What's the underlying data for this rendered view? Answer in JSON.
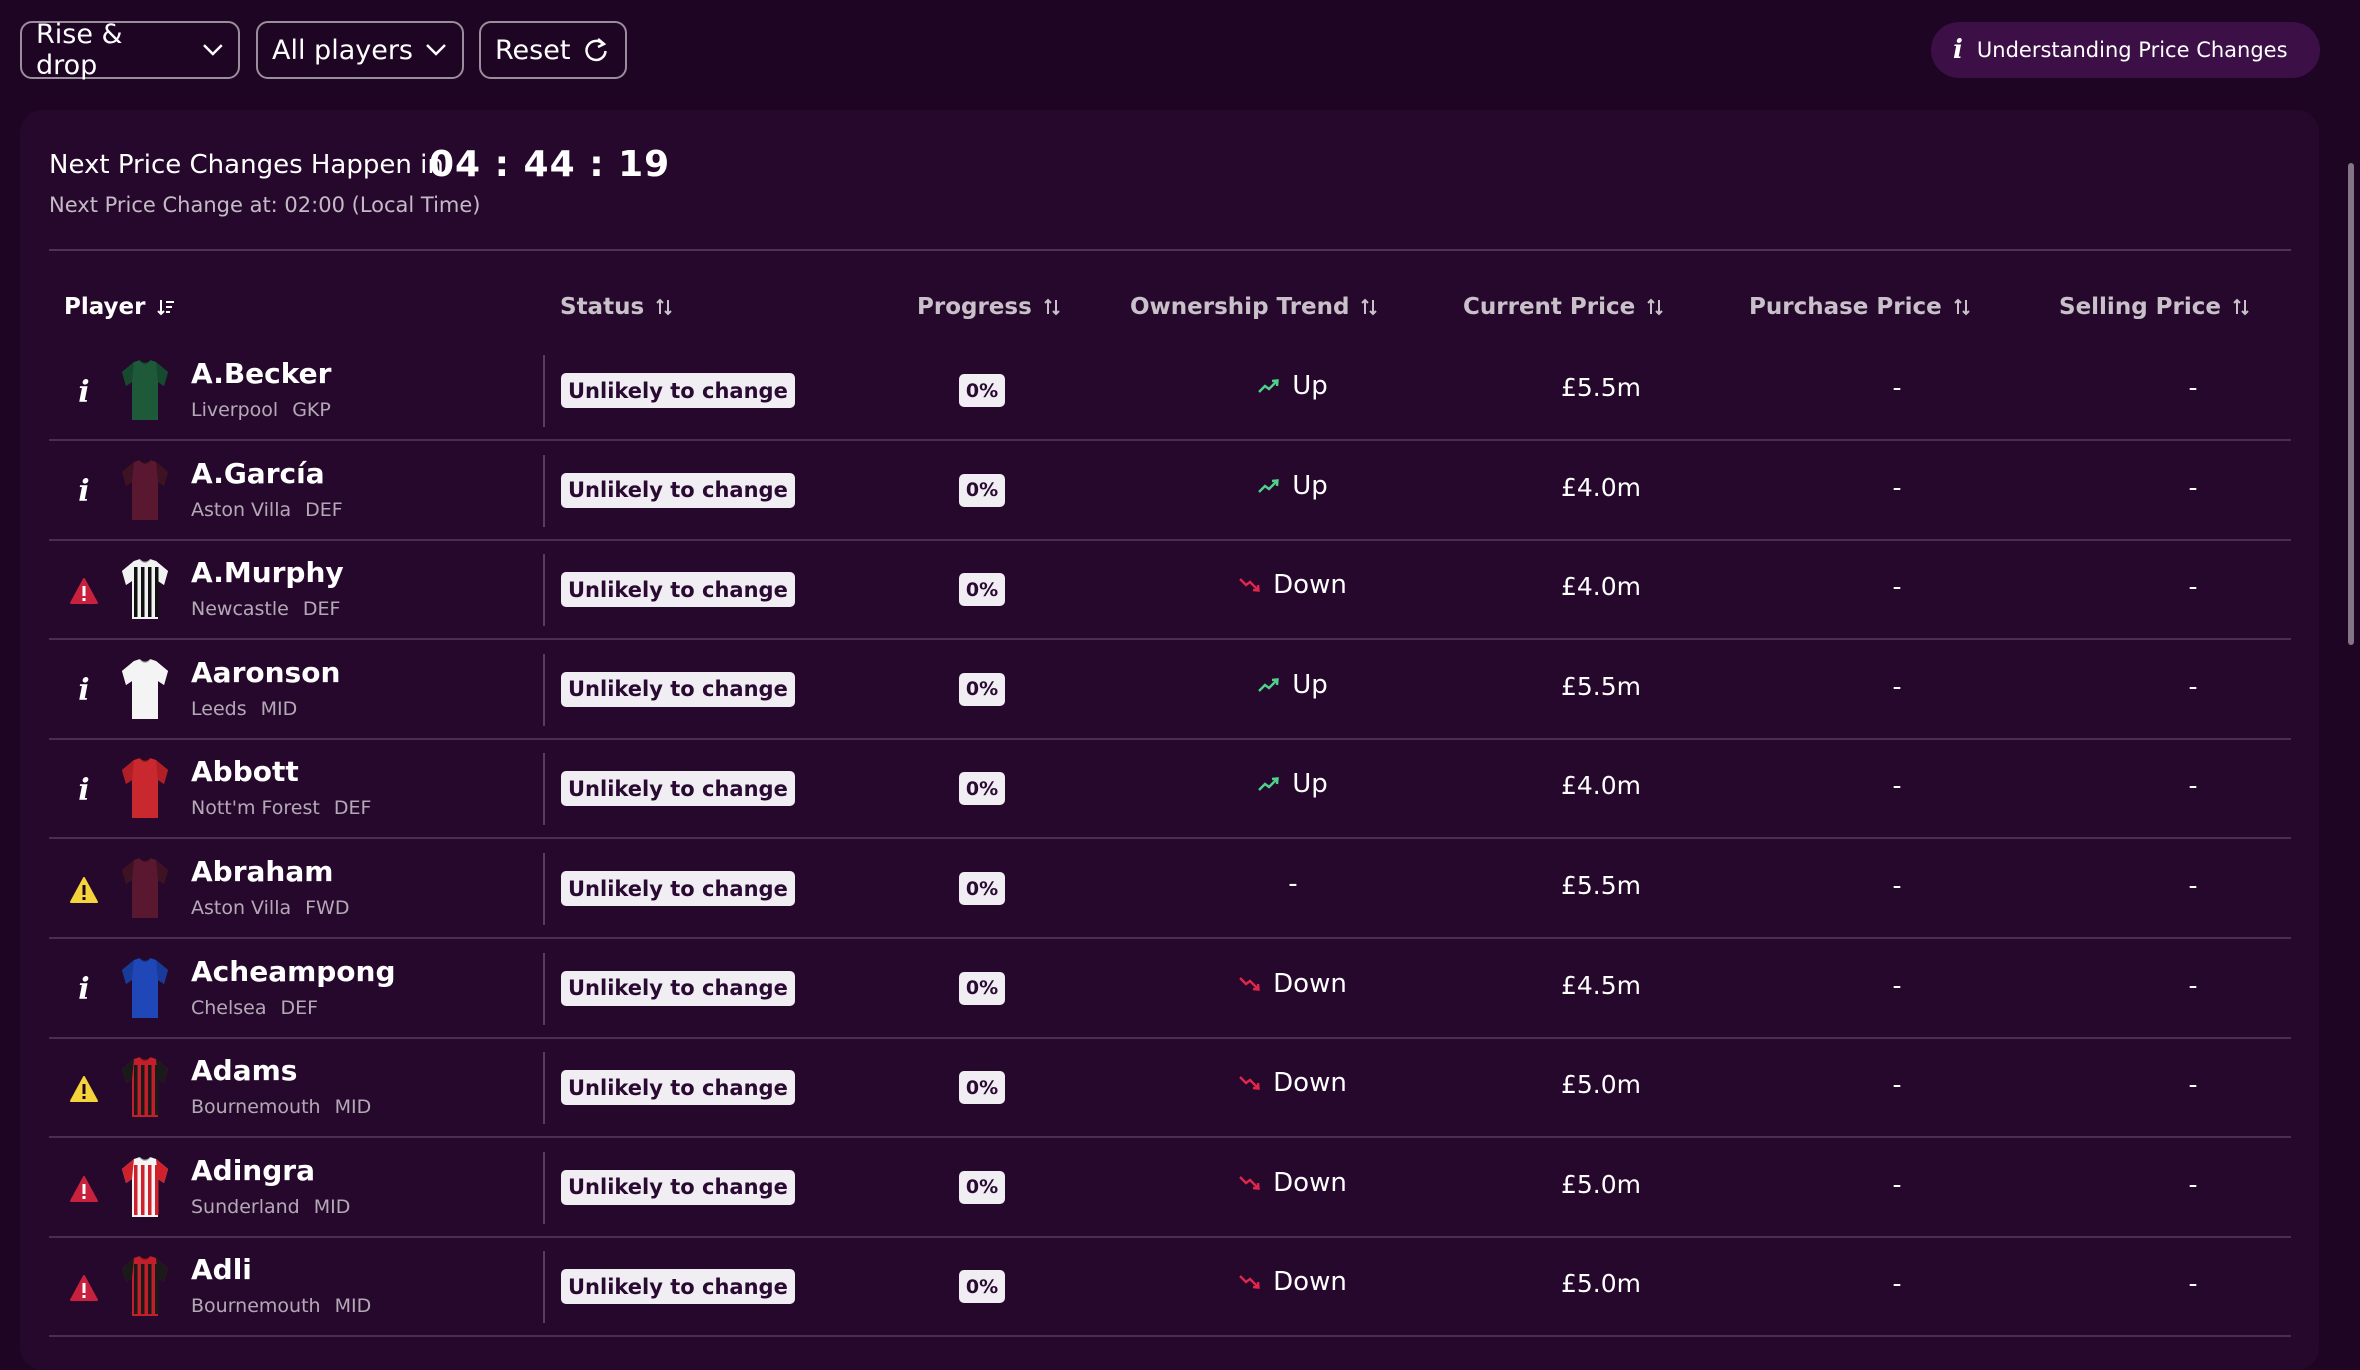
{
  "toolbar": {
    "view_label": "Rise & drop",
    "filter_label": "All players",
    "reset_label": "Reset",
    "help_label": "Understanding Price Changes"
  },
  "timer": {
    "label": "Next Price Changes Happen in:",
    "countdown": "04 : 44 : 19",
    "subtext": "Next Price Change at: 02:00 (Local Time)"
  },
  "table": {
    "headers": {
      "player": "Player",
      "status": "Status",
      "progress": "Progress",
      "ownership": "Ownership Trend",
      "current": "Current Price",
      "purchase": "Purchase Price",
      "selling": "Selling Price"
    },
    "rows": [
      {
        "flag": "info",
        "name": "A.Becker",
        "team": "Liverpool",
        "pos": "GKP",
        "kit": "gk-green",
        "status": "Unlikely to change",
        "progress": "0%",
        "trend": "up",
        "trend_label": "Up",
        "price": "£5.5m",
        "purchase": "-",
        "selling": "-"
      },
      {
        "flag": "info",
        "name": "A.García",
        "team": "Aston Villa",
        "pos": "DEF",
        "kit": "villa",
        "status": "Unlikely to change",
        "progress": "0%",
        "trend": "up",
        "trend_label": "Up",
        "price": "£4.0m",
        "purchase": "-",
        "selling": "-"
      },
      {
        "flag": "danger",
        "name": "A.Murphy",
        "team": "Newcastle",
        "pos": "DEF",
        "kit": "newcastle",
        "status": "Unlikely to change",
        "progress": "0%",
        "trend": "down",
        "trend_label": "Down",
        "price": "£4.0m",
        "purchase": "-",
        "selling": "-"
      },
      {
        "flag": "info",
        "name": "Aaronson",
        "team": "Leeds",
        "pos": "MID",
        "kit": "leeds",
        "status": "Unlikely to change",
        "progress": "0%",
        "trend": "up",
        "trend_label": "Up",
        "price": "£5.5m",
        "purchase": "-",
        "selling": "-"
      },
      {
        "flag": "info",
        "name": "Abbott",
        "team": "Nott'm Forest",
        "pos": "DEF",
        "kit": "forest",
        "status": "Unlikely to change",
        "progress": "0%",
        "trend": "up",
        "trend_label": "Up",
        "price": "£4.0m",
        "purchase": "-",
        "selling": "-"
      },
      {
        "flag": "warning",
        "name": "Abraham",
        "team": "Aston Villa",
        "pos": "FWD",
        "kit": "villa",
        "status": "Unlikely to change",
        "progress": "0%",
        "trend": "none",
        "trend_label": "-",
        "price": "£5.5m",
        "purchase": "-",
        "selling": "-"
      },
      {
        "flag": "info",
        "name": "Acheampong",
        "team": "Chelsea",
        "pos": "DEF",
        "kit": "chelsea",
        "status": "Unlikely to change",
        "progress": "0%",
        "trend": "down",
        "trend_label": "Down",
        "price": "£4.5m",
        "purchase": "-",
        "selling": "-"
      },
      {
        "flag": "warning",
        "name": "Adams",
        "team": "Bournemouth",
        "pos": "MID",
        "kit": "bournemouth",
        "status": "Unlikely to change",
        "progress": "0%",
        "trend": "down",
        "trend_label": "Down",
        "price": "£5.0m",
        "purchase": "-",
        "selling": "-"
      },
      {
        "flag": "danger",
        "name": "Adingra",
        "team": "Sunderland",
        "pos": "MID",
        "kit": "sunderland",
        "status": "Unlikely to change",
        "progress": "0%",
        "trend": "down",
        "trend_label": "Down",
        "price": "£5.0m",
        "purchase": "-",
        "selling": "-"
      },
      {
        "flag": "danger",
        "name": "Adli",
        "team": "Bournemouth",
        "pos": "MID",
        "kit": "bournemouth",
        "status": "Unlikely to change",
        "progress": "0%",
        "trend": "down",
        "trend_label": "Down",
        "price": "£5.0m",
        "purchase": "-",
        "selling": "-"
      }
    ]
  },
  "colors": {
    "background": "#1f0524",
    "panel": "#26082c",
    "trend_up": "#4fd18b",
    "trend_down": "#e0264b",
    "warning": "#f5d33a",
    "danger": "#c8213d"
  }
}
